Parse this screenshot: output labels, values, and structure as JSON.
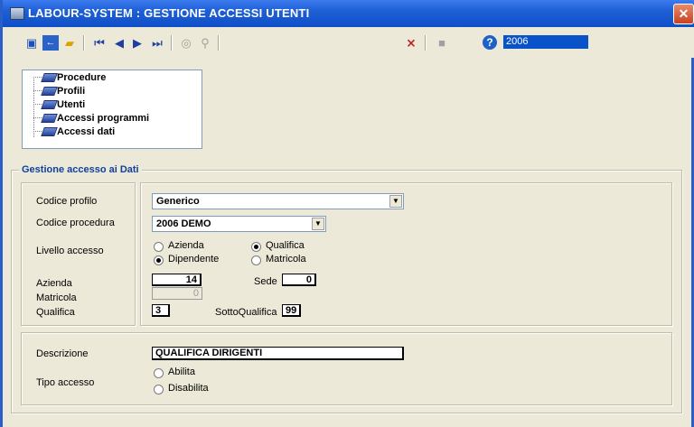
{
  "window": {
    "title": "LABOUR-SYSTEM : GESTIONE ACCESSI UTENTI",
    "close_label": "✕"
  },
  "toolbar": {
    "year": "2006",
    "help_label": "?"
  },
  "tree": {
    "items": [
      "Procedure",
      "Profili",
      "Utenti",
      "Accessi programmi",
      "Accessi dati"
    ]
  },
  "group": {
    "title": "Gestione accesso ai Dati"
  },
  "form": {
    "codice_profilo_label": "Codice profilo",
    "codice_profilo_value": "Generico",
    "codice_procedura_label": "Codice procedura",
    "codice_procedura_value": "2006  DEMO",
    "livello_accesso_label": "Livello accesso",
    "livello_options": {
      "azienda": "Azienda",
      "qualifica": "Qualifica",
      "dipendente": "Dipendente",
      "matricola": "Matricola"
    },
    "livello_selected": [
      "Qualifica",
      "Dipendente"
    ],
    "azienda_label": "Azienda",
    "azienda_value": "14",
    "sede_label": "Sede",
    "sede_value": "0",
    "matricola_label": "Matricola",
    "matricola_value": "0",
    "qualifica_label": "Qualifica",
    "qualifica_value": "3",
    "sottoqualifica_label": "SottoQualifica",
    "sottoqualifica_value": "99",
    "descrizione_label": "Descrizione",
    "descrizione_value": "QUALIFICA DIRIGENTI",
    "tipo_accesso_label": "Tipo accesso",
    "tipo_options": {
      "abilita": "Abilita",
      "disabilita": "Disabilita"
    }
  },
  "colors": {
    "titlebar": "#0f4fc7",
    "group_title": "#1040a0",
    "year_bg": "#0a52c9"
  }
}
